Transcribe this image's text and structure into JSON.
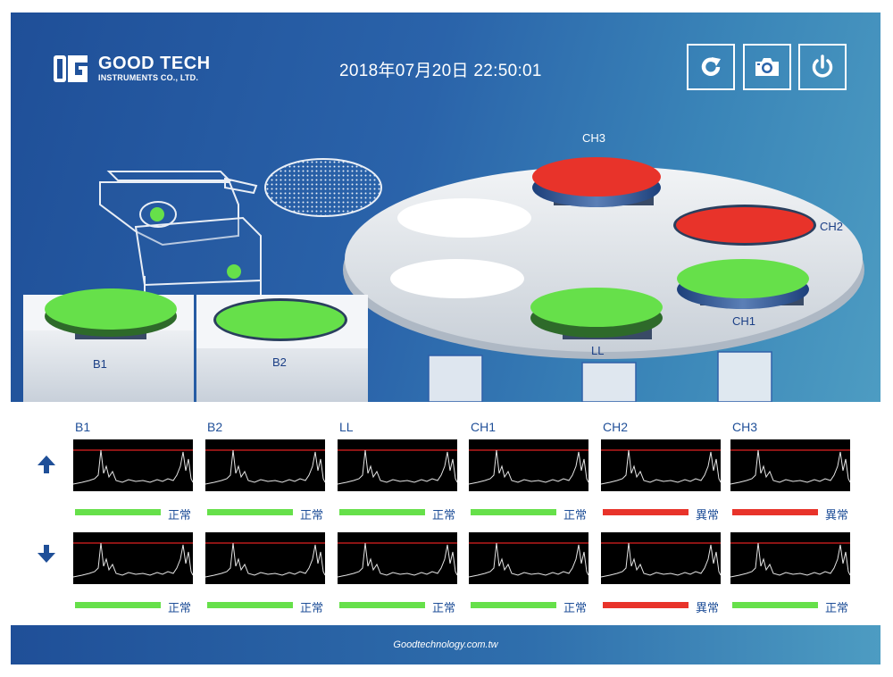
{
  "header": {
    "company_name": "GOOD TECH",
    "company_sub": "INSTRUMENTS CO., LTD.",
    "datetime": "2018年07月20日 22:50:01",
    "buttons": [
      {
        "name": "refresh",
        "icon": "refresh-icon"
      },
      {
        "name": "camera",
        "icon": "camera-icon"
      },
      {
        "name": "power",
        "icon": "power-icon"
      }
    ]
  },
  "scene": {
    "stations": [
      {
        "label": "B1",
        "state": "normal"
      },
      {
        "label": "B2",
        "state": "normal"
      },
      {
        "label": "LL",
        "state": "normal"
      },
      {
        "label": "CH1",
        "state": "normal"
      },
      {
        "label": "CH2",
        "state": "abnormal"
      },
      {
        "label": "CH3",
        "state": "abnormal"
      }
    ]
  },
  "monitor": {
    "up_icon": "arrow-up-icon",
    "down_icon": "arrow-down-icon",
    "channels": [
      {
        "name": "B1",
        "upper_status": "正常",
        "lower_status": "正常",
        "upper_state": "normal",
        "lower_state": "normal"
      },
      {
        "name": "B2",
        "upper_status": "正常",
        "lower_status": "正常",
        "upper_state": "normal",
        "lower_state": "normal"
      },
      {
        "name": "LL",
        "upper_status": "正常",
        "lower_status": "正常",
        "upper_state": "normal",
        "lower_state": "normal"
      },
      {
        "name": "CH1",
        "upper_status": "正常",
        "lower_status": "正常",
        "upper_state": "normal",
        "lower_state": "normal"
      },
      {
        "name": "CH2",
        "upper_status": "異常",
        "lower_status": "異常",
        "upper_state": "abnormal",
        "lower_state": "abnormal"
      },
      {
        "name": "CH3",
        "upper_status": "異常",
        "lower_status": "正常",
        "upper_state": "abnormal",
        "lower_state": "normal"
      }
    ]
  },
  "colors": {
    "normal": "#66e04a",
    "abnormal": "#e8332a",
    "brand": "#1f4f98",
    "threshold": "#e02020",
    "trace": "#e6e6e6"
  },
  "footer": {
    "site": "Goodtechnology.com.tw"
  }
}
